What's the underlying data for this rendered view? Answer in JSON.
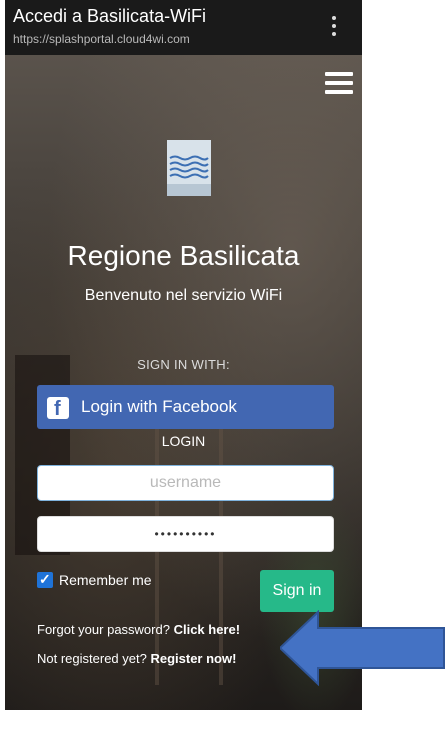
{
  "browser": {
    "title": "Accedi a Basilicata-WiFi",
    "url": "https://splashportal.cloud4wi.com"
  },
  "portal": {
    "region_title": "Regione Basilicata",
    "welcome_text": "Benvenuto nel servizio WiFi",
    "sign_in_with": "SIGN IN WITH:",
    "facebook_button": "Login with Facebook",
    "login_heading": "LOGIN",
    "username_placeholder": "username",
    "password_value": "••••••••••",
    "remember_label": "Remember me",
    "remember_checked": true,
    "sign_in_button": "Sign in",
    "forgot_text": "Forgot your password?",
    "forgot_link": "Click here!",
    "register_text": "Not registered yet?",
    "register_link": "Register now!"
  },
  "colors": {
    "facebook": "#4267b2",
    "sign_in": "#26b989",
    "arrow": "#4472c4",
    "checkbox": "#1f73d8"
  },
  "icons": [
    "kebab-menu-icon",
    "hamburger-menu-icon",
    "region-logo",
    "facebook-icon",
    "checkbox-check-icon",
    "annotation-arrow"
  ]
}
